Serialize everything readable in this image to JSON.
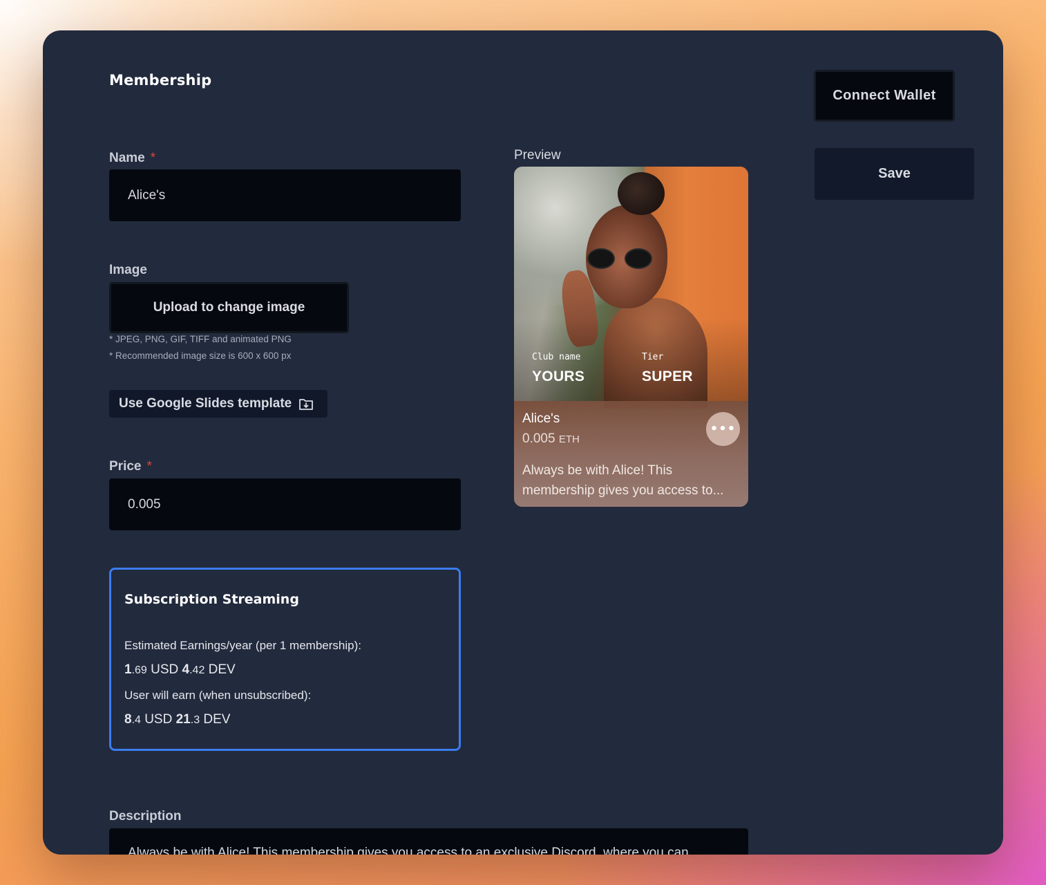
{
  "page": {
    "title": "Membership"
  },
  "actions": {
    "connect_wallet": "Connect Wallet",
    "save": "Save"
  },
  "form": {
    "name": {
      "label": "Name",
      "required_mark": "*",
      "value": "Alice's"
    },
    "image": {
      "label": "Image",
      "upload_button": "Upload to change image",
      "hints": [
        "* JPEG, PNG, GIF, TIFF and animated PNG",
        "* Recommended image size is 600 x 600 px"
      ],
      "template_button": "Use Google Slides template"
    },
    "price": {
      "label": "Price",
      "required_mark": "*",
      "value": "0.005"
    },
    "description": {
      "label": "Description",
      "value": "Always be with Alice! This membership gives you access to an exclusive Discord, where you can"
    }
  },
  "streaming": {
    "title": "Subscription Streaming",
    "earnings_label": "Estimated Earnings/year (per 1 membership):",
    "earnings": {
      "usd_int": "1",
      "usd_dec": ".69",
      "usd_unit": "USD",
      "dev_int": "4",
      "dev_dec": ".42",
      "dev_unit": "DEV"
    },
    "unsubscribed_label": "User will earn (when unsubscribed):",
    "unsubscribed": {
      "usd_int": "8",
      "usd_dec": ".4",
      "usd_unit": "USD",
      "dev_int": "21",
      "dev_dec": ".3",
      "dev_unit": "DEV"
    }
  },
  "preview": {
    "label": "Preview",
    "club_label": "Club name",
    "club_value": "YOURS",
    "tier_label": "Tier",
    "tier_value": "SUPER",
    "name": "Alice's",
    "price": "0.005",
    "price_unit": "ETH",
    "description": "Always be with Alice! This membership gives you access to...",
    "more_icon": "ellipsis-icon"
  }
}
